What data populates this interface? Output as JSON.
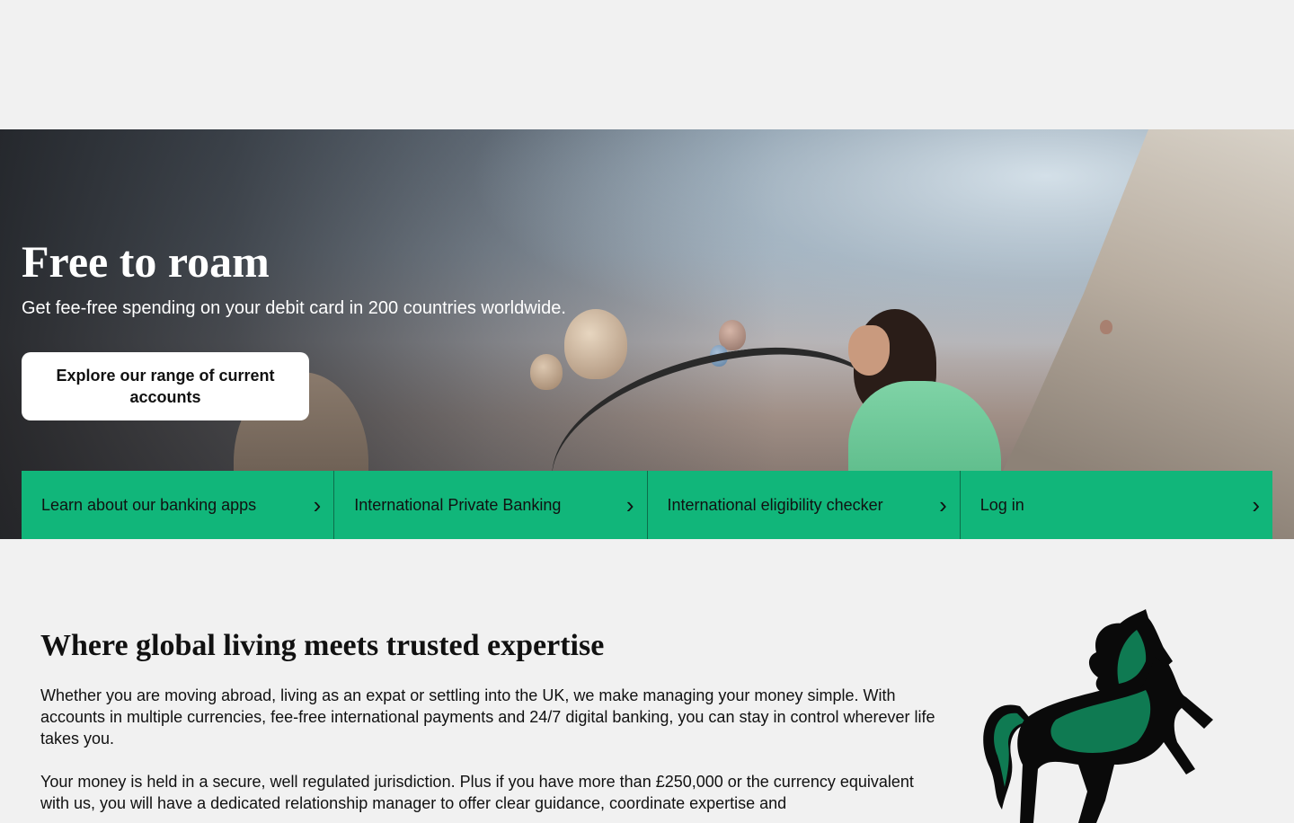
{
  "hero": {
    "title": "Free to roam",
    "subtitle": "Get fee-free spending on your debit card in 200 countries worldwide.",
    "cta_label": "Explore our range of current accounts"
  },
  "quick_links": [
    {
      "label": "Learn about our banking apps"
    },
    {
      "label": "International Private Banking"
    },
    {
      "label": "International eligibility checker"
    },
    {
      "label": "Log in"
    }
  ],
  "content": {
    "title": "Where global living meets trusted expertise",
    "paragraph1": "Whether you are moving abroad, living as an expat or settling into the UK, we make managing your money simple. With accounts in multiple currencies, fee-free international payments and 24/7 digital banking, you can stay in control wherever life takes you.",
    "paragraph2": "Your money is held in a secure, well regulated jurisdiction. Plus if you have more than £250,000 or the currency equivalent with us, you will have a dedicated relationship manager to offer clear guidance, coordinate expertise and"
  },
  "colors": {
    "brand_green": "#11b67a",
    "page_bg": "#f1f1f1",
    "horse_green": "#0f7a52"
  },
  "icons": {
    "chevron": "chevron-right-icon",
    "logo": "black-horse-logo"
  }
}
